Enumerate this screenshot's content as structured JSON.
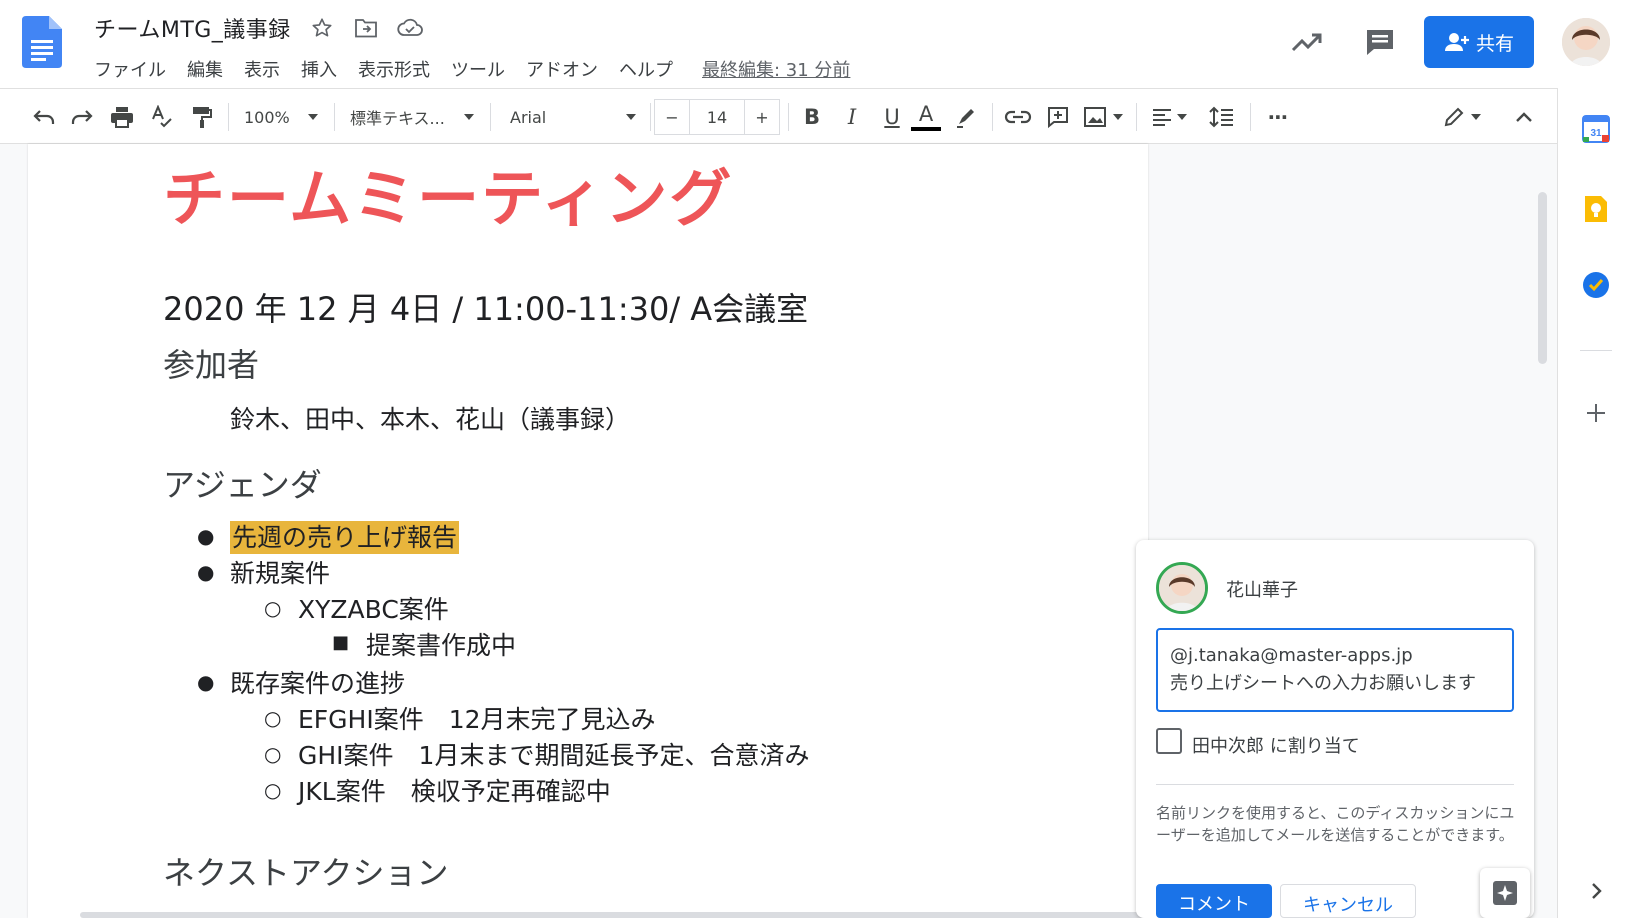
{
  "header": {
    "title": "チームMTG_議事録",
    "menu": [
      "ファイル",
      "編集",
      "表示",
      "挿入",
      "表示形式",
      "ツール",
      "アドオン",
      "ヘルプ"
    ],
    "last_edit": "最終編集: 31 分前",
    "share_label": "共有"
  },
  "toolbar": {
    "zoom": "100%",
    "style": "標準テキス...",
    "font": "Arial",
    "font_size": "14",
    "minus": "−",
    "plus": "+",
    "bold": "B",
    "italic": "I",
    "underline": "U",
    "text_color": "A",
    "more": "⋯"
  },
  "document": {
    "heading": "チームミーティング",
    "date_line": "2020 年 12 月 4日 / 11:00-11:30/ A会議室",
    "participants_heading": "参加者",
    "participants": "鈴木、田中、本木、花山（議事録）",
    "agenda_heading": "アジェンダ",
    "agenda": {
      "item1": "先週の売り上げ報告",
      "item2": "新規案件",
      "item2_sub1": "XYZABC案件",
      "item2_sub1_sub1": "提案書作成中",
      "item3": "既存案件の進捗",
      "item3_sub1": "EFGHI案件　12月末完了見込み",
      "item3_sub2": "GHI案件　1月末まで期間延長予定、合意済み",
      "item3_sub3": "JKL案件　検収予定再確認中"
    },
    "next_action_heading": "ネクストアクション"
  },
  "comment": {
    "author": "花山華子",
    "input_line1": "@j.tanaka@master-apps.jp",
    "input_line2": "売り上げシートへの入力お願いします",
    "assign_label": "田中次郎 に割り当て",
    "help_text": "名前リンクを使用すると、このディスカッションにユーザーを追加してメールを送信することができます。",
    "comment_button": "コメント",
    "cancel_button": "キャンセル"
  },
  "side_panel": {
    "calendar_day": "31"
  },
  "colors": {
    "accent_blue": "#1a73e8",
    "heading_red": "#ee5558",
    "highlight": "#e8b53c"
  }
}
